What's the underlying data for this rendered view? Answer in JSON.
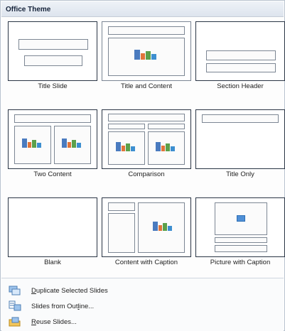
{
  "gallery": {
    "title": "Office Theme",
    "layouts": [
      {
        "label": "Title Slide"
      },
      {
        "label": "Title and Content"
      },
      {
        "label": "Section Header"
      },
      {
        "label": "Two Content"
      },
      {
        "label": "Comparison"
      },
      {
        "label": "Title Only"
      },
      {
        "label": "Blank"
      },
      {
        "label": "Content with Caption"
      },
      {
        "label": "Picture with Caption"
      }
    ]
  },
  "menu": {
    "duplicate": {
      "accel": "D",
      "rest": "uplicate Selected Slides",
      "icon": "duplicate-slides-icon"
    },
    "outline": {
      "before": "Slides from Out",
      "accel": "l",
      "after": "ine...",
      "icon": "slides-from-outline-icon"
    },
    "reuse": {
      "accel": "R",
      "rest": "euse Slides...",
      "icon": "reuse-slides-icon"
    }
  }
}
